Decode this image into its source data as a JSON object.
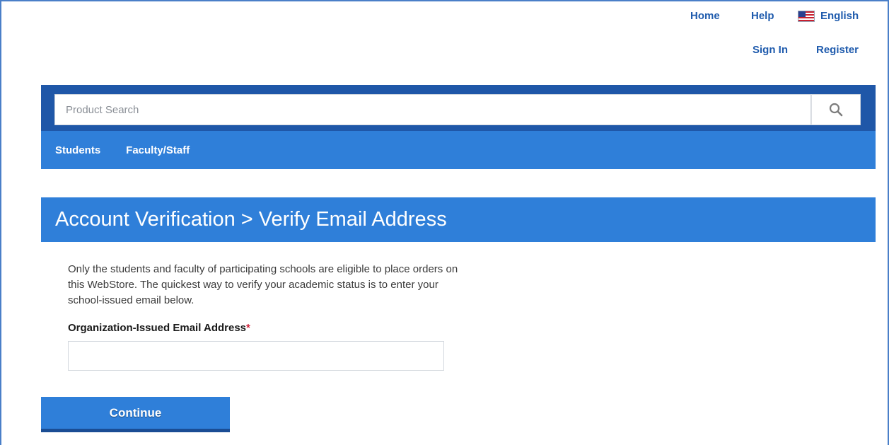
{
  "header": {
    "links": {
      "home": "Home",
      "help": "Help",
      "language": "English",
      "sign_in": "Sign In",
      "register": "Register"
    },
    "language_icon": "us-flag-icon"
  },
  "search": {
    "placeholder": "Product Search",
    "value": "",
    "button_icon": "search-icon"
  },
  "nav": {
    "items": [
      {
        "label": "Students"
      },
      {
        "label": "Faculty/Staff"
      }
    ]
  },
  "page": {
    "title": "Account Verification > Verify Email Address",
    "intro": "Only the students and faculty of participating schools are eligible to place orders on this WebStore. The quickest way to verify your academic status is to enter your school-issued email below.",
    "email_label": "Organization-Issued Email Address",
    "required_marker": "*",
    "email_value": "",
    "continue_label": "Continue"
  },
  "colors": {
    "brand_dark": "#1f57a8",
    "brand": "#2f7fd9",
    "link": "#1f5bad",
    "required": "#d0223a"
  }
}
